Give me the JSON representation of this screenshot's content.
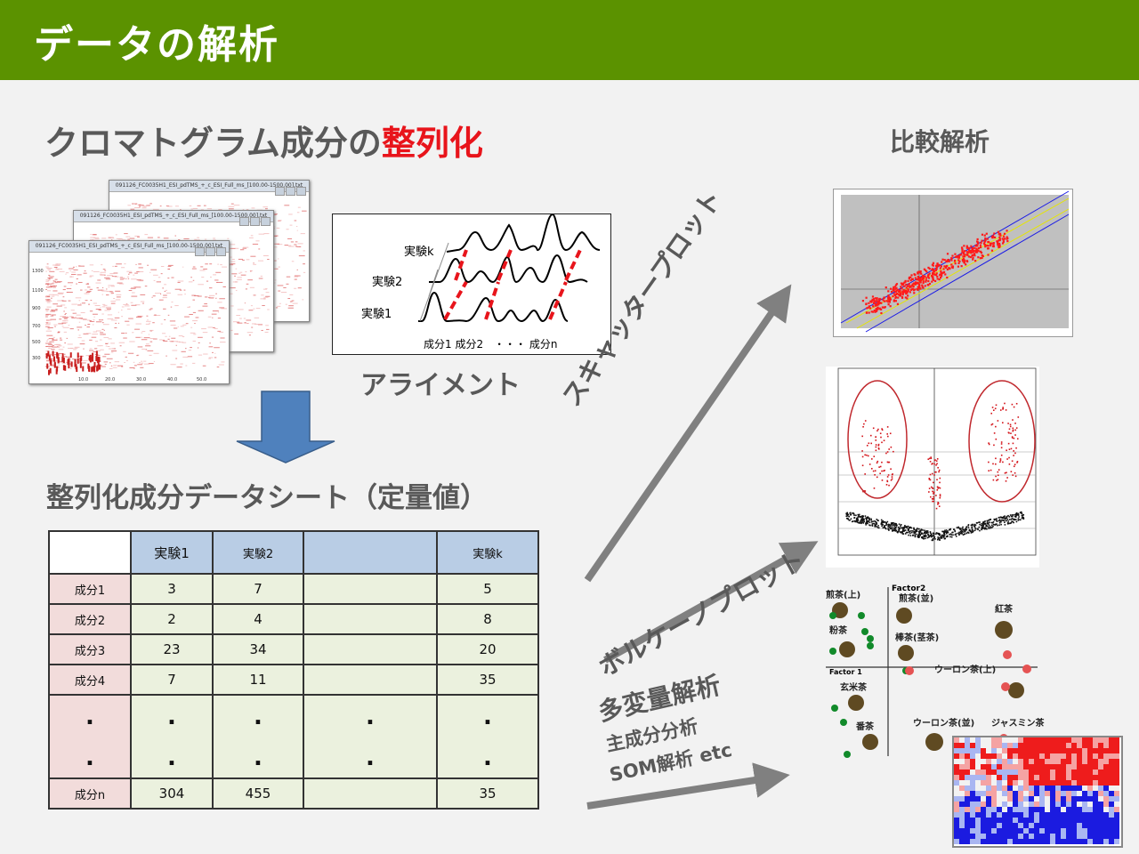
{
  "header": {
    "title": "データの解析"
  },
  "alignment_section": {
    "title_main": "クロマトグラム成分の",
    "title_accent": "整列化",
    "label": "アライメント",
    "diagram": {
      "rows": [
        "実験k",
        "実験2",
        "実験1"
      ],
      "footer": "成分1 成分2　・・・ 成分n"
    },
    "windows": [
      "091126_FC0035H1_ESI_pdTMS_+_c_ESI_Full_ms_[100.00-1500.00].txt",
      "091126_FC0035H1_ESI_pdTMS_+_c_ESI_Full_ms_[100.00-1500.00].txt",
      "091126_FC0035H1_ESI_pdTMS_+_c_ESI_Full_ms_[100.00-1500.00].txt"
    ]
  },
  "comparison": {
    "title": "比較解析"
  },
  "sheet": {
    "title": "整列化成分データシート（定量値）",
    "headers": [
      "",
      "実験1",
      "実験2",
      "",
      "実験k"
    ],
    "rows": [
      [
        "成分1",
        "3",
        "7",
        "",
        "5"
      ],
      [
        "成分2",
        "2",
        "4",
        "",
        "8"
      ],
      [
        "成分3",
        "23",
        "34",
        "",
        "20"
      ],
      [
        "成分4",
        "7",
        "11",
        "",
        "35"
      ],
      [
        ".",
        ".",
        ".",
        ".",
        "."
      ],
      [
        ".",
        ".",
        ".",
        ".",
        "."
      ],
      [
        "成分n",
        "304",
        "455",
        "",
        "35"
      ]
    ]
  },
  "arrows": {
    "scatter": "スキャッタープロット",
    "volcano": "ボルケーノプロット",
    "multivariate": "多変量解析",
    "pca": "主成分分析",
    "som": "SOM解析 etc"
  },
  "pca_plot": {
    "factor2": "Factor2",
    "factor1": "Factor 1",
    "labels": [
      "煎茶(上)",
      "煎茶(並)",
      "紅茶",
      "粉茶",
      "棒茶(茎茶)",
      "ウーロン茶(上)",
      "玄米茶",
      "番茶",
      "ウーロン茶(並)",
      "ジャスミン茶"
    ]
  },
  "colors": {
    "header": "#5b9200",
    "accent": "#e8141b",
    "table_header": "#b9cde5",
    "row_label": "#f2dcdb",
    "cell": "#ebf1de"
  }
}
